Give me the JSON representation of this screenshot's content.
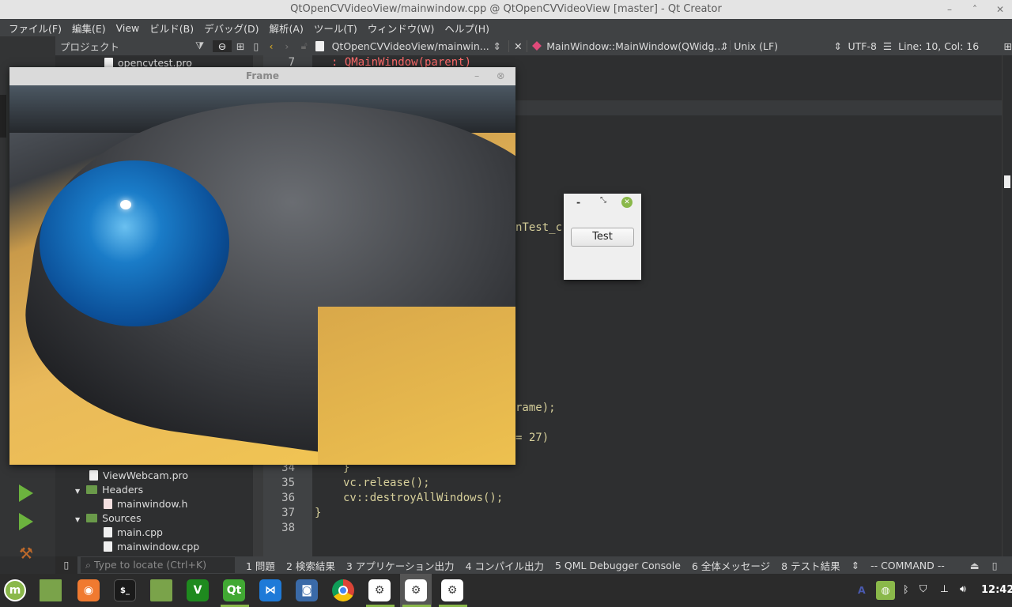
{
  "window": {
    "title": "QtOpenCVVideoView/mainwindow.cpp @ QtOpenCVVideoView [master] - Qt Creator",
    "minimize": "–",
    "maximize": "˄",
    "close": "✕"
  },
  "menu": [
    "ファイル(F)",
    "編集(E)",
    "View",
    "ビルド(B)",
    "デバッグ(D)",
    "解析(A)",
    "ツール(T)",
    "ウィンドウ(W)",
    "ヘルプ(H)"
  ],
  "project": {
    "header": "プロジェクト",
    "items": [
      {
        "label": "opencvtest.pro",
        "type": "pro"
      },
      {
        "label": "ViewWebcam.pro",
        "type": "pro"
      },
      {
        "label": "Headers",
        "type": "folder"
      },
      {
        "label": "mainwindow.h",
        "type": "h"
      },
      {
        "label": "Sources",
        "type": "folder"
      },
      {
        "label": "main.cpp",
        "type": "cpp"
      },
      {
        "label": "mainwindow.cpp",
        "type": "cpp"
      }
    ]
  },
  "editor": {
    "file": "QtOpenCVVideoView/mainwin...",
    "symbol": "MainWindow::MainWindow(QWidg...",
    "line_ending": "Unix (LF)",
    "encoding": "UTF-8",
    "position": "Line: 10, Col: 16",
    "lines": [
      {
        "n": "7",
        "text": ": QMainWindow(parent)"
      },
      {
        "n": "34",
        "text": "}"
      },
      {
        "n": "35",
        "text": "vc.release();"
      },
      {
        "n": "36",
        "text": "cv::destroyAllWindows();"
      },
      {
        "n": "37",
        "text": "}"
      },
      {
        "n": "38",
        "text": ""
      }
    ],
    "fragments": [
      "nTest_c",
      "rame);",
      "= 27)"
    ]
  },
  "output": {
    "locate_placeholder": "Type to locate (Ctrl+K)",
    "tabs": [
      "1  問題",
      "2  検索結果",
      "3  アプリケーション出力",
      "4  コンパイル出力",
      "5  QML Debugger Console",
      "6  全体メッセージ",
      "8  テスト結果"
    ],
    "mode": "-- COMMAND --"
  },
  "frame_window": {
    "title": "Frame"
  },
  "dialog": {
    "button": "Test"
  },
  "taskbar": {
    "apps": [
      "mint-menu",
      "desktop",
      "firefox",
      "terminal",
      "files",
      "vim",
      "qt-creator",
      "vscode",
      "screenshot",
      "chrome",
      "settings",
      "settings",
      "settings"
    ],
    "clock": "12:42",
    "keyboard": "A"
  },
  "colors": {
    "accent": "#8ab84a",
    "keyword": "#ff6aad",
    "code": "#d6cf9a"
  }
}
